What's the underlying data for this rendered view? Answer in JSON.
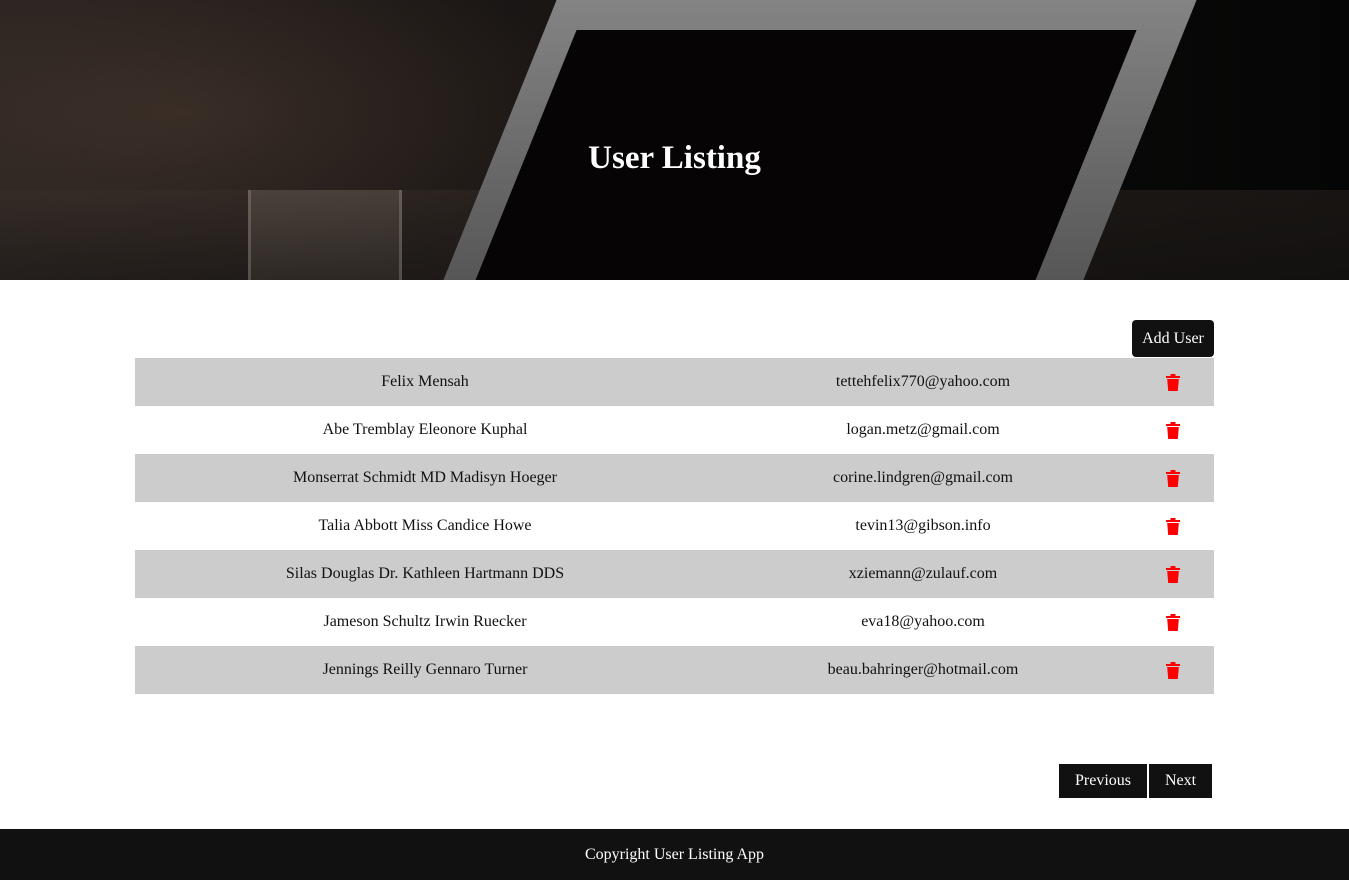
{
  "header": {
    "title": "User Listing"
  },
  "toolbar": {
    "add_user_label": "Add User"
  },
  "users": [
    {
      "name": "Felix Mensah",
      "email": "tettehfelix770@yahoo.com"
    },
    {
      "name": "Abe Tremblay Eleonore Kuphal",
      "email": "logan.metz@gmail.com"
    },
    {
      "name": "Monserrat Schmidt MD Madisyn Hoeger",
      "email": "corine.lindgren@gmail.com"
    },
    {
      "name": "Talia Abbott Miss Candice Howe",
      "email": "tevin13@gibson.info"
    },
    {
      "name": "Silas Douglas Dr. Kathleen Hartmann DDS",
      "email": "xziemann@zulauf.com"
    },
    {
      "name": "Jameson Schultz Irwin Ruecker",
      "email": "eva18@yahoo.com"
    },
    {
      "name": "Jennings Reilly Gennaro Turner",
      "email": "beau.bahringer@hotmail.com"
    }
  ],
  "row_action_icon": "trash-icon",
  "pagination": {
    "previous_label": "Previous",
    "next_label": "Next"
  },
  "footer": {
    "text": "Copyright User Listing App"
  },
  "colors": {
    "accent_dark": "#111111",
    "row_shade": "#cccccc",
    "delete_red": "#ff0000"
  }
}
